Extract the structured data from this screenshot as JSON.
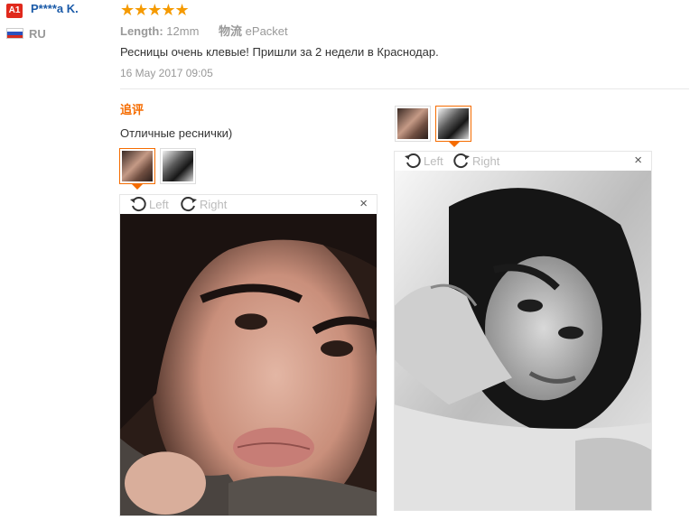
{
  "reviewer": {
    "badge": "A1",
    "name": "P****a K.",
    "country": "RU",
    "flag_colors": [
      "#ffffff",
      "#2a52be",
      "#d52b1e"
    ]
  },
  "rating": {
    "stars": "★★★★★",
    "count": 5
  },
  "attributes": {
    "length_label": "Length:",
    "length_value": "12mm",
    "shipping_label": "物流",
    "shipping_value": "ePacket"
  },
  "review": {
    "text": "Ресницы очень клевые! Пришли за 2 недели в Краснодар.",
    "date": "16 May 2017 09:05"
  },
  "followup": {
    "label": "追评",
    "text": "Отличные реснички)"
  },
  "viewer": {
    "rotate_left": "Left",
    "rotate_right": "Right",
    "close": "×"
  },
  "colors": {
    "accent": "#f56c00",
    "link": "#1a5aa8",
    "star": "#f59a00",
    "badge": "#e0291c"
  }
}
